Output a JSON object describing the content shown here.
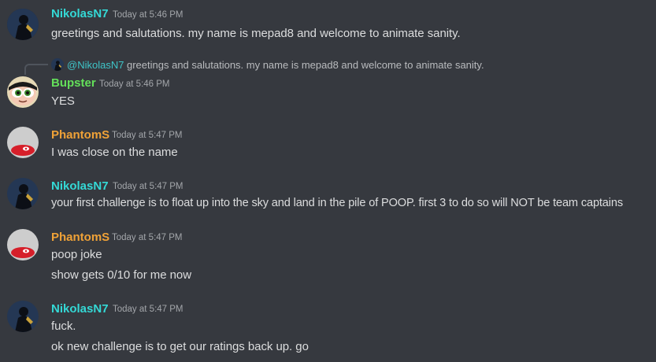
{
  "colors": {
    "background": "#36393f",
    "nikolas": "#34d9d6",
    "bupster": "#64e05a",
    "phantom": "#f0a237",
    "timestamp": "#a3a6aa",
    "text": "#dcddde"
  },
  "reply": {
    "avatar_icon": "dark-figure-avatar-icon",
    "mention": "@NikolasN7",
    "text": "greetings and salutations. my name is mepad8 and welcome to animate sanity."
  },
  "messages": [
    {
      "author": "NikolasN7",
      "timestamp": "Today at 5:46 PM",
      "avatar_icon": "dark-figure-avatar-icon",
      "lines": [
        "greetings and salutations. my name is mepad8 and welcome to animate sanity."
      ]
    },
    {
      "author": "Bupster",
      "timestamp": "Today at 5:46 PM",
      "avatar_icon": "cartoon-face-avatar-icon",
      "lines": [
        "YES"
      ]
    },
    {
      "author": "PhantomS",
      "timestamp": "Today at 5:47 PM",
      "avatar_icon": "red-cap-avatar-icon",
      "lines": [
        "I was close on the name"
      ]
    },
    {
      "author": "NikolasN7",
      "timestamp": "Today at 5:47 PM",
      "avatar_icon": "dark-figure-avatar-icon",
      "lines": [
        "your first challenge is to float up into the sky and land in the pile of POOP. first 3 to do so will NOT be team captains"
      ]
    },
    {
      "author": "PhantomS",
      "timestamp": "Today at 5:47 PM",
      "avatar_icon": "red-cap-avatar-icon",
      "lines": [
        "poop joke",
        "show gets 0/10 for me now"
      ]
    },
    {
      "author": "NikolasN7",
      "timestamp": "Today at 5:47 PM",
      "avatar_icon": "dark-figure-avatar-icon",
      "lines": [
        "fuck.",
        "ok new challenge is to get our ratings back up. go"
      ]
    }
  ]
}
